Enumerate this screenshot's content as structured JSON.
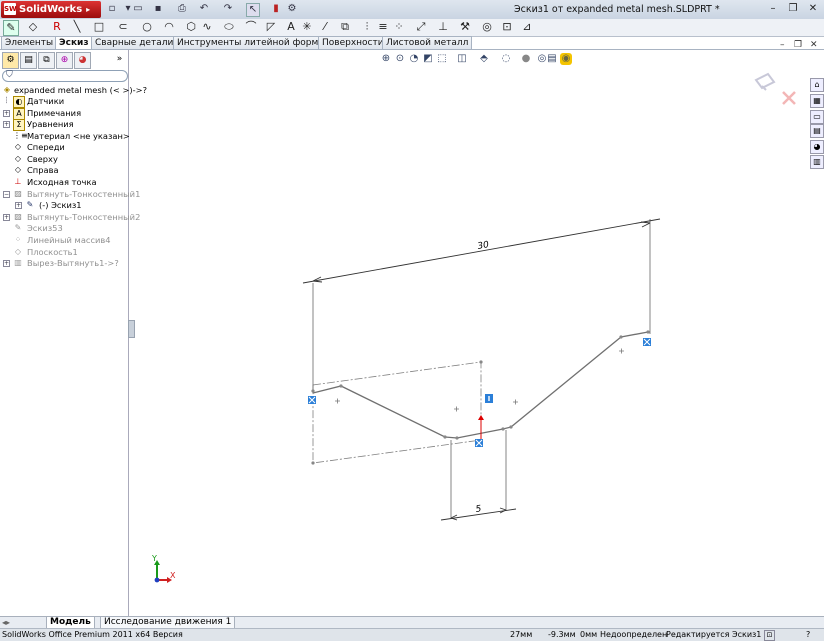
{
  "app": {
    "brand": "SolidWorks",
    "window_title": "Эскиз1 от expanded metal mesh.SLDPRT *"
  },
  "tabs": [
    "Элементы",
    "Эскиз",
    "Сварные детали",
    "Инструменты литейной формы",
    "Поверхности",
    "Листовой металл"
  ],
  "active_tab": "Эскиз",
  "tree": {
    "root": "expanded metal mesh  (< >)->?",
    "items": [
      {
        "label": "Датчики",
        "icon": "sensor-icon"
      },
      {
        "label": "Примечания",
        "icon": "annotation-icon"
      },
      {
        "label": "Уравнения",
        "icon": "equation-icon"
      },
      {
        "label": "Материал <не указан>",
        "icon": "material-icon"
      },
      {
        "label": "Спереди",
        "icon": "plane-icon"
      },
      {
        "label": "Сверху",
        "icon": "plane-icon"
      },
      {
        "label": "Справа",
        "icon": "plane-icon"
      },
      {
        "label": "Исходная точка",
        "icon": "origin-icon"
      },
      {
        "label": "Вытянуть-Тонкостенный1",
        "icon": "extrude-icon"
      },
      {
        "label": "(-) Эскиз1",
        "icon": "sketch-icon"
      },
      {
        "label": "Вытянуть-Тонкостенный2",
        "icon": "extrude-icon"
      },
      {
        "label": "Эскиз53",
        "icon": "sketch-icon"
      },
      {
        "label": "Линейный массив4",
        "icon": "pattern-icon"
      },
      {
        "label": "Плоскость1",
        "icon": "plane-icon"
      },
      {
        "label": "Вырез-Вытянуть1->?",
        "icon": "cut-icon"
      }
    ]
  },
  "sketch": {
    "dimension_top": "30",
    "dimension_bottom": "5"
  },
  "triad": {
    "y": "Y",
    "x": "X"
  },
  "bottom_tabs": [
    "Модель",
    "Исследование движения 1"
  ],
  "status": {
    "version": "SolidWorks Office Premium 2011 x64 Версия",
    "x": "27мм",
    "y": "-9.3мм",
    "z": "0мм",
    "state": "Недоопределен",
    "editing": "Редактируется Эскиз1"
  }
}
